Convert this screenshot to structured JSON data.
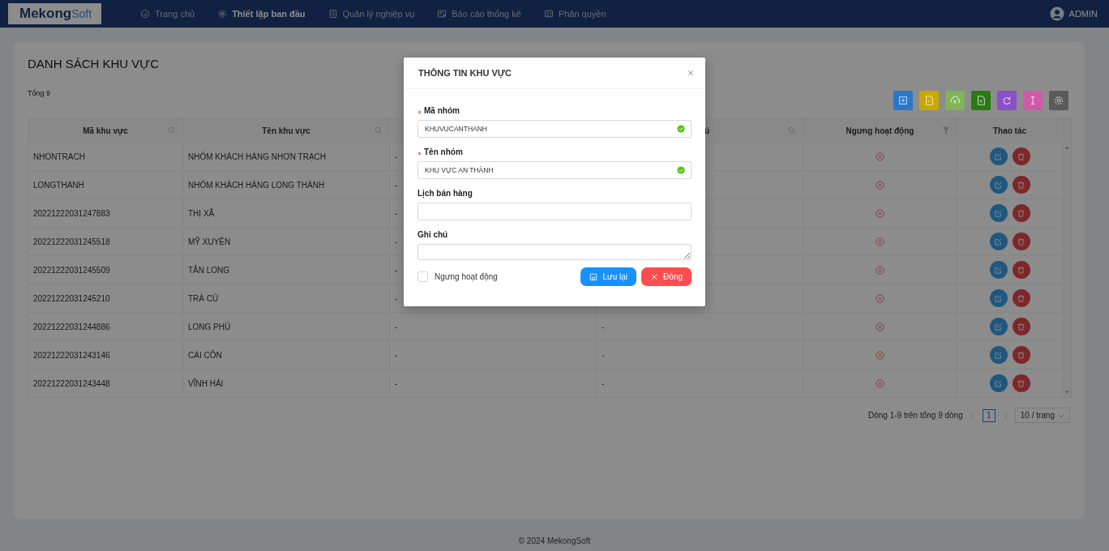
{
  "header": {
    "logo": {
      "main": "Mekong",
      "accent": "Soft"
    },
    "nav": [
      {
        "label": "Trang chủ",
        "selected": false
      },
      {
        "label": "Thiết lập ban đầu",
        "selected": true
      },
      {
        "label": "Quản lý nghiệp vụ",
        "selected": false
      },
      {
        "label": "Báo cáo thống kê",
        "selected": false
      },
      {
        "label": "Phân quyền",
        "selected": false
      }
    ],
    "user": "ADMIN"
  },
  "list": {
    "title": "DANH SÁCH KHU VỰC",
    "total": "Tổng 9",
    "toolbar": [
      {
        "color": "#2a78c8"
      },
      {
        "color": "#c9a800"
      },
      {
        "color": "#7fb458"
      },
      {
        "color": "#2a7a10"
      },
      {
        "color": "#8a50c8"
      },
      {
        "color": "#d05aa8"
      },
      {
        "color": "#5a5a5a"
      }
    ],
    "columns": [
      {
        "label": "Mã khu vực",
        "kind": "search"
      },
      {
        "label": "Tên khu vực",
        "kind": "search"
      },
      {
        "kind": "plain"
      },
      {
        "label": "ú",
        "kind": "search"
      },
      {
        "label": "Ngưng hoạt động",
        "kind": "filter"
      },
      {
        "label": "Thao tác",
        "kind": "plain"
      }
    ],
    "rows": [
      {
        "code": "NHONTRACH",
        "name": "NHÓM KHÁCH HÀNG NHƠN TRẠCH",
        "column_3": "-",
        "stopped": false
      },
      {
        "code": "LONGTHANH",
        "name": "NHÓM KHÁCH HÀNG LONG THÀNH",
        "column_3": "-",
        "stopped": false
      },
      {
        "code": "20221222031247883",
        "name": "THỊ XÃ",
        "column_3": "-",
        "stopped": false
      },
      {
        "code": "20221222031245518",
        "name": "MỸ XUYÊN",
        "column_3": "-",
        "stopped": false
      },
      {
        "code": "20221222031245509",
        "name": "TÂN LONG",
        "column_3": "-",
        "stopped": false
      },
      {
        "code": "20221222031245210",
        "name": "TRÀ CÚ",
        "column_3": "-",
        "stopped": false
      },
      {
        "code": "20221222031244886",
        "name": "LONG PHÚ",
        "column_3": "-",
        "column_4": "-",
        "stopped": false
      },
      {
        "code": "20221222031243146",
        "name": "CÁI CÔN",
        "column_3": "-",
        "column_4": "-",
        "stopped": false
      },
      {
        "code": "20221222031243448",
        "name": "VĨNH HẢI",
        "column_3": "-",
        "column_4": "-",
        "stopped": false
      }
    ],
    "pagination": {
      "summary": "Dòng 1-9 trên tổng 9 dòng",
      "pages": [
        {
          "label": "1",
          "selected": true
        }
      ],
      "page_size": "10 / trang"
    }
  },
  "footer": "© 2024 MekongSoft",
  "modal": {
    "title": "THÔNG TIN KHU VỰC",
    "fields": [
      {
        "kind": "input",
        "label": "Mã nhóm",
        "required": true,
        "value": "KHUVUCANTHANH",
        "valid": true
      },
      {
        "kind": "input",
        "label": "Tên nhóm",
        "required": true,
        "value": "KHU VỰC AN THÀNH",
        "valid": true
      },
      {
        "kind": "input",
        "label": "Lịch bán hàng",
        "required": false,
        "valid": false
      },
      {
        "kind": "textarea",
        "label": "Ghi chú",
        "required": false,
        "valid": false
      }
    ],
    "stop_checkbox": {
      "label": "Ngưng hoạt động",
      "checked": false
    },
    "buttons": [
      {
        "kind": "save",
        "label": "Lưu lại"
      },
      {
        "kind": "close",
        "label": "Đóng"
      }
    ]
  }
}
